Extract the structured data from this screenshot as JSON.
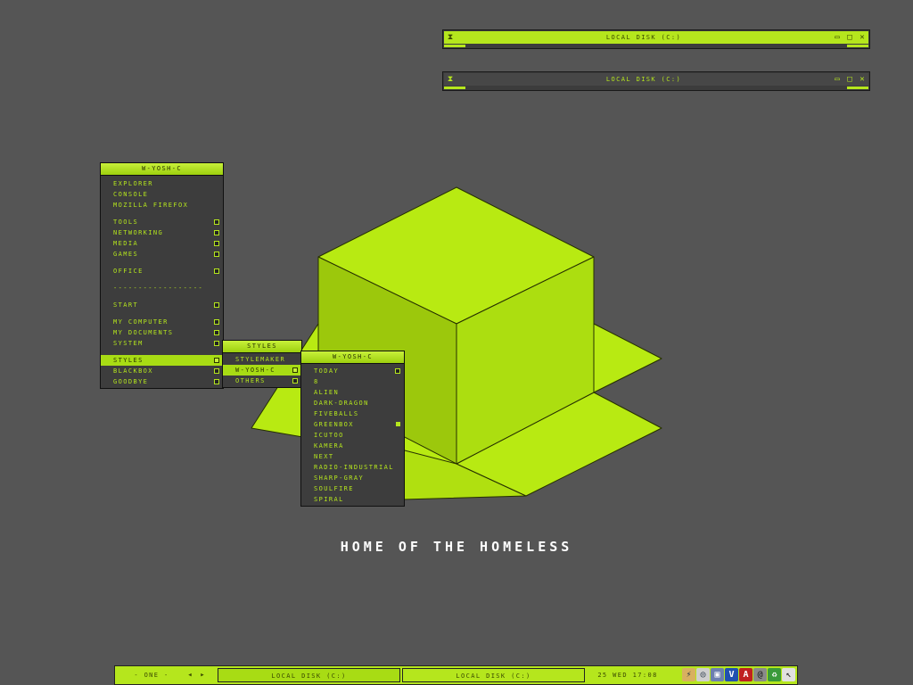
{
  "colors": {
    "accent": "#b5e61d",
    "background": "#555555",
    "cube_top": "#b8ea12",
    "cube_left": "#9cc80c",
    "cube_right": "#acde10"
  },
  "windows": [
    {
      "title": "LOCAL DISK (C:)",
      "icon": "hourglass-icon",
      "minimize": "▭",
      "maximize": "□",
      "close": "✕"
    },
    {
      "title": "LOCAL DISK (C:)",
      "icon": "hourglass-icon",
      "minimize": "▭",
      "maximize": "□",
      "close": "✕"
    }
  ],
  "window_icon_glyph": "⧗",
  "root_menu": {
    "title": "W-YOSH-C",
    "items": [
      {
        "label": "EXPLORER"
      },
      {
        "label": "CONSOLE"
      },
      {
        "label": "MOZILLA FIREFOX"
      },
      {
        "label": "TOOLS"
      },
      {
        "label": "NETWORKING"
      },
      {
        "label": "MEDIA"
      },
      {
        "label": "GAMES"
      },
      {
        "label": "OFFICE"
      },
      {
        "label": "------------------"
      },
      {
        "label": "START"
      },
      {
        "label": "MY COMPUTER"
      },
      {
        "label": "MY DOCUMENTS"
      },
      {
        "label": "SYSTEM"
      },
      {
        "label": "STYLES"
      },
      {
        "label": "BLACKBOX"
      },
      {
        "label": "GOODBYE"
      }
    ]
  },
  "styles_menu": {
    "title": "STYLES",
    "items": [
      {
        "label": "STYLEMAKER"
      },
      {
        "label": "W-YOSH-C"
      },
      {
        "label": "OTHERS"
      }
    ]
  },
  "theme_menu": {
    "title": "W-YOSH-C",
    "items": [
      {
        "label": "TODAY"
      },
      {
        "label": "8"
      },
      {
        "label": "ALIEN"
      },
      {
        "label": "DARK-DRAGON"
      },
      {
        "label": "FIVEBALLS"
      },
      {
        "label": "GREENBOX"
      },
      {
        "label": "ICUTOO"
      },
      {
        "label": "KAMERA"
      },
      {
        "label": "NEXT"
      },
      {
        "label": "RADIO-INDUSTRIAL"
      },
      {
        "label": "SHARP-GRAY"
      },
      {
        "label": "SOULFIRE"
      },
      {
        "label": "SPIRAL"
      }
    ]
  },
  "tagline": "HOME OF THE HOMELESS",
  "taskbar": {
    "workspace": "- ONE -",
    "prev": "◂",
    "next": "▸",
    "tasks": [
      "LOCAL DISK (C:)",
      "LOCAL DISK (C:)"
    ],
    "clock": "25 WED 17:08",
    "tray_icons": [
      {
        "name": "network-icon",
        "glyph": "⚡"
      },
      {
        "name": "cd-icon",
        "glyph": "◎"
      },
      {
        "name": "monitor-icon",
        "glyph": "▣"
      },
      {
        "name": "antivirus-icon",
        "glyph": "V"
      },
      {
        "name": "ati-icon",
        "glyph": "A"
      },
      {
        "name": "spiral-icon",
        "glyph": "@"
      },
      {
        "name": "recycle-icon",
        "glyph": "♻"
      },
      {
        "name": "cursor-icon",
        "glyph": "↖"
      }
    ]
  }
}
